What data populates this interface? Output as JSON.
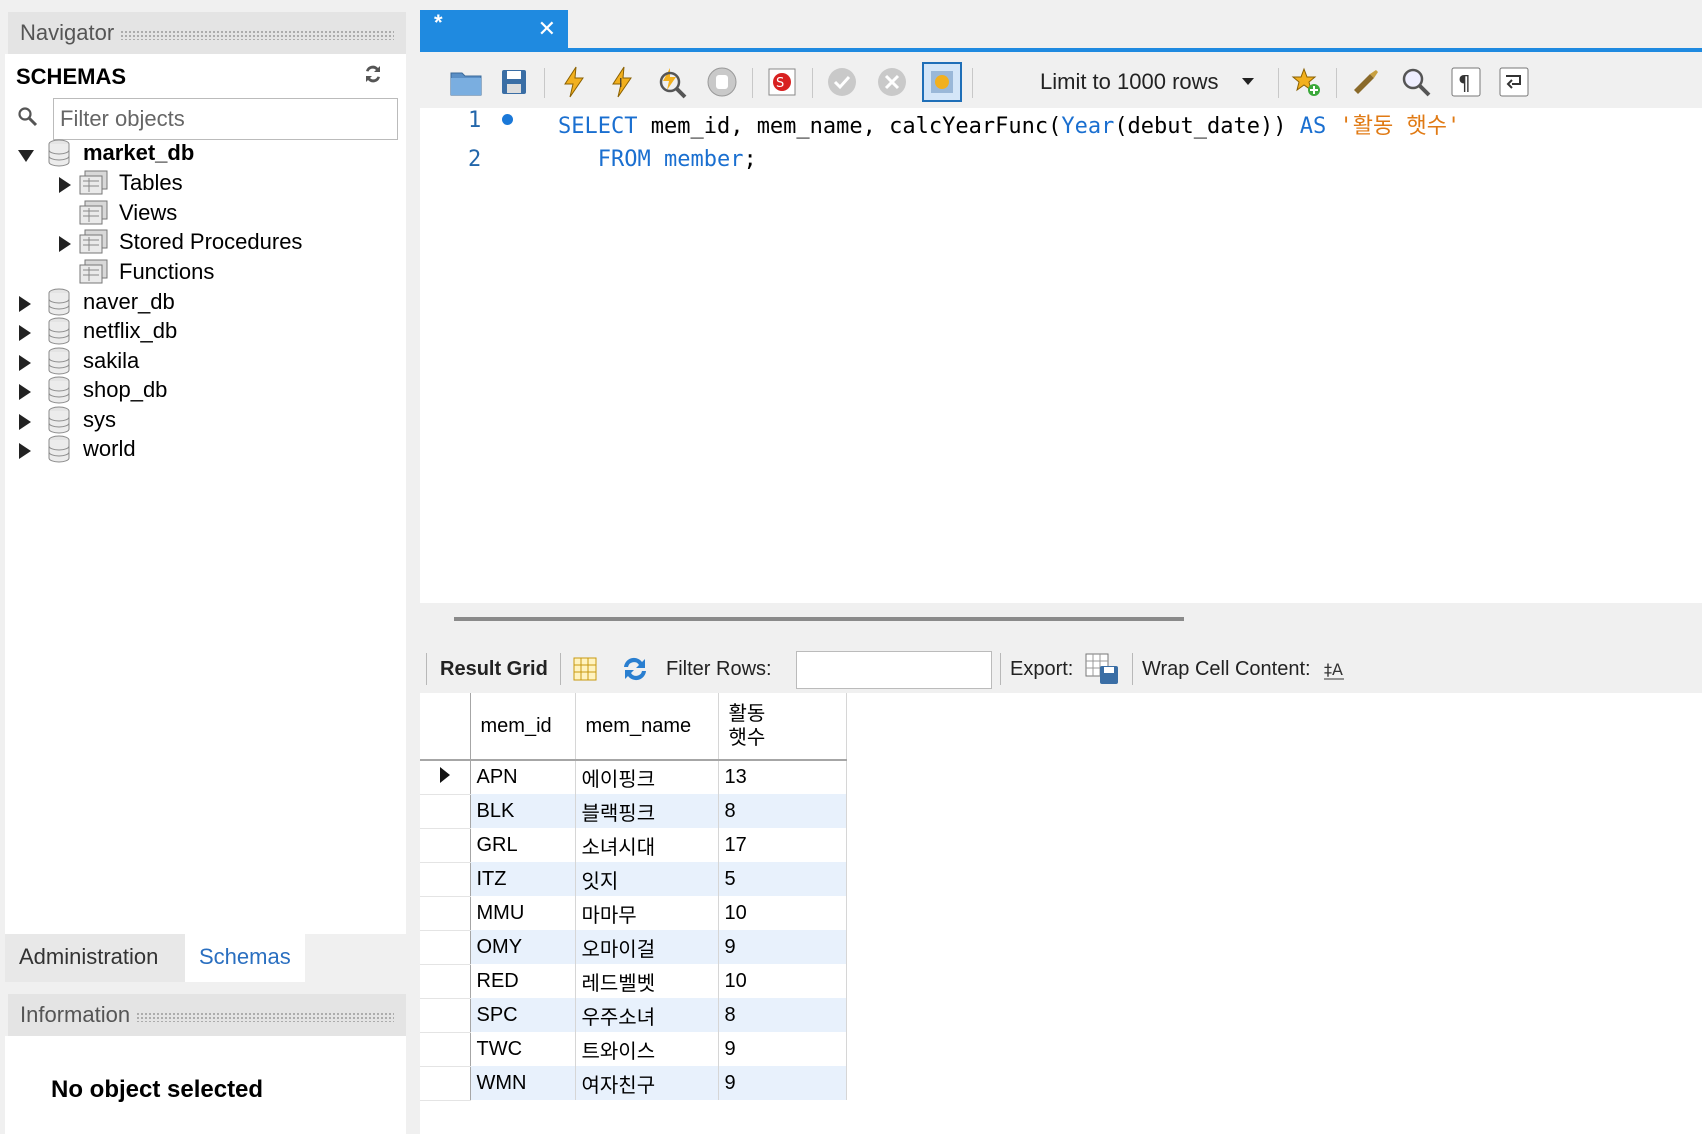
{
  "navigator": {
    "title": "Navigator",
    "schemas_label": "SCHEMAS",
    "filter_placeholder": "Filter objects",
    "tree": [
      {
        "name": "market_db",
        "expanded": true,
        "bold": true
      },
      {
        "name": "Tables"
      },
      {
        "name": "Views"
      },
      {
        "name": "Stored Procedures"
      },
      {
        "name": "Functions"
      },
      {
        "name": "naver_db"
      },
      {
        "name": "netflix_db"
      },
      {
        "name": "sakila"
      },
      {
        "name": "shop_db"
      },
      {
        "name": "sys"
      },
      {
        "name": "world"
      }
    ],
    "tabs": {
      "administration": "Administration",
      "schemas": "Schemas"
    }
  },
  "information": {
    "title": "Information",
    "message": "No object selected"
  },
  "query_tab": {
    "title": "*",
    "close": "✕"
  },
  "toolbar": {
    "limit_label": "Limit to 1000 rows"
  },
  "editor": {
    "lines": [
      {
        "number": "1",
        "has_dot": true
      },
      {
        "number": "2",
        "has_dot": false
      }
    ],
    "line1": {
      "kw_select": "SELECT",
      "part1": " mem_id, mem_name, calcYearFunc(",
      "kw_year": "Year",
      "part2": "(debut_date)) ",
      "kw_as": "AS",
      "space": " ",
      "alias": "'활동 햇수'"
    },
    "line2": {
      "indent": "   ",
      "kw_from": "FROM",
      "space": " ",
      "table": "member",
      "semicolon": ";"
    }
  },
  "result_toolbar": {
    "result_grid": "Result Grid",
    "filter_rows": "Filter Rows:",
    "export": "Export:",
    "wrap": "Wrap Cell Content:"
  },
  "grid": {
    "columns": [
      "mem_id",
      "mem_name",
      "활동\n햇수"
    ],
    "rows": [
      [
        "APN",
        "에이핑크",
        "13"
      ],
      [
        "BLK",
        "블랙핑크",
        "8"
      ],
      [
        "GRL",
        "소녀시대",
        "17"
      ],
      [
        "ITZ",
        "잇지",
        "5"
      ],
      [
        "MMU",
        "마마무",
        "10"
      ],
      [
        "OMY",
        "오마이걸",
        "9"
      ],
      [
        "RED",
        "레드벨벳",
        "10"
      ],
      [
        "SPC",
        "우주소녀",
        "8"
      ],
      [
        "TWC",
        "트와이스",
        "9"
      ],
      [
        "WMN",
        "여자친구",
        "9"
      ]
    ]
  },
  "colors": {
    "accent": "#1f8ae0",
    "keyword": "#1a6fd0",
    "string": "#e07a14",
    "alt_row": "#e8f1fc"
  }
}
